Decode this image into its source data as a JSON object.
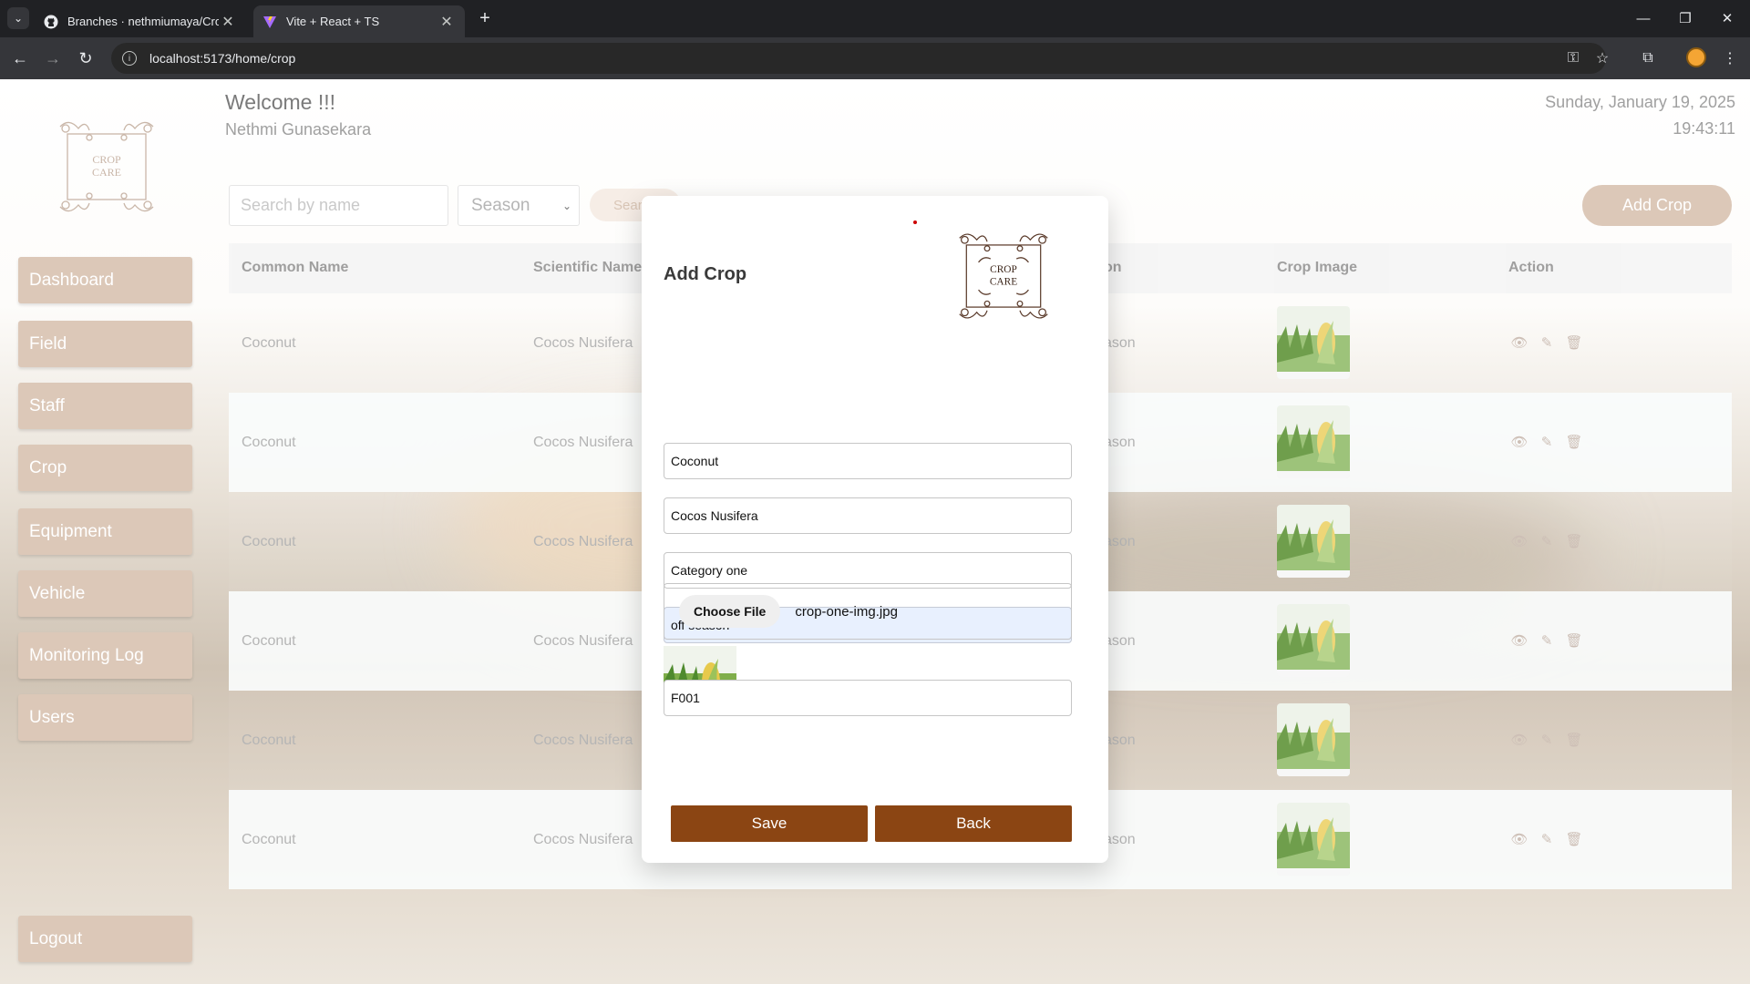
{
  "browser": {
    "tabs": [
      {
        "title": "Branches · nethmiumaya/CropC",
        "active": false
      },
      {
        "title": "Vite + React + TS",
        "active": true
      }
    ],
    "url": "localhost:5173/home/crop"
  },
  "header": {
    "welcome": "Welcome !!!",
    "user_name": "Nethmi Gunasekara",
    "date": "Sunday, January 19, 2025",
    "time": "19:43:11"
  },
  "logo": {
    "line1": "CROP",
    "line2": "CARE"
  },
  "sidebar": {
    "items": [
      {
        "label": "Dashboard"
      },
      {
        "label": "Field"
      },
      {
        "label": "Staff"
      },
      {
        "label": "Crop"
      },
      {
        "label": "Equipment"
      },
      {
        "label": "Vehicle"
      },
      {
        "label": "Monitoring Log"
      },
      {
        "label": "Users"
      }
    ],
    "logout": "Logout"
  },
  "filters": {
    "search_placeholder": "Search by name",
    "season_value": "Season",
    "search_button": "Sear",
    "add_button": "Add Crop"
  },
  "table": {
    "headers": [
      "Common Name",
      "Scientific Name",
      "on",
      "Crop Image",
      "Action"
    ],
    "rows": [
      {
        "common": "Coconut",
        "scientific": "Cocos Nusifera",
        "season": "ason"
      },
      {
        "common": "Coconut",
        "scientific": "Cocos Nusifera",
        "season": "ason"
      },
      {
        "common": "Coconut",
        "scientific": "Cocos Nusifera",
        "season": "ason"
      },
      {
        "common": "Coconut",
        "scientific": "Cocos Nusifera",
        "season": "ason"
      },
      {
        "common": "Coconut",
        "scientific": "Cocos Nusifera",
        "season": "ason"
      },
      {
        "common": "Coconut",
        "scientific": "Cocos Nusifera",
        "season": "ason"
      }
    ]
  },
  "modal": {
    "title": "Add Crop",
    "common_name": "Coconut",
    "scientific_name": "Cocos Nusifera",
    "category": "Category one",
    "season": "off season",
    "choose_file": "Choose File",
    "file_name": "crop-one-img.jpg",
    "field_code": "F001",
    "save": "Save",
    "back": "Back"
  },
  "colors": {
    "brand_brown": "#8b4513",
    "sidebar_button": "#dcc8b8"
  }
}
